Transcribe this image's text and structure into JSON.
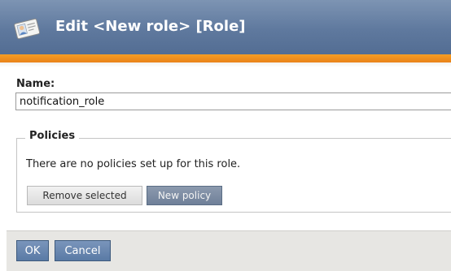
{
  "header": {
    "title": "Edit <New role> [Role]",
    "icon": "role-card-icon"
  },
  "form": {
    "name_label": "Name:",
    "name_value": "notification_role"
  },
  "policies": {
    "legend": "Policies",
    "empty_message": "There are no policies set up for this role.",
    "remove_selected_label": "Remove selected",
    "new_policy_label": "New policy"
  },
  "footer": {
    "ok_label": "OK",
    "cancel_label": "Cancel"
  },
  "colors": {
    "header_blue": "#5f799e",
    "accent_orange": "#e9821a",
    "button_blue": "#5a7aa5",
    "footer_gray": "#e7e6e3"
  }
}
